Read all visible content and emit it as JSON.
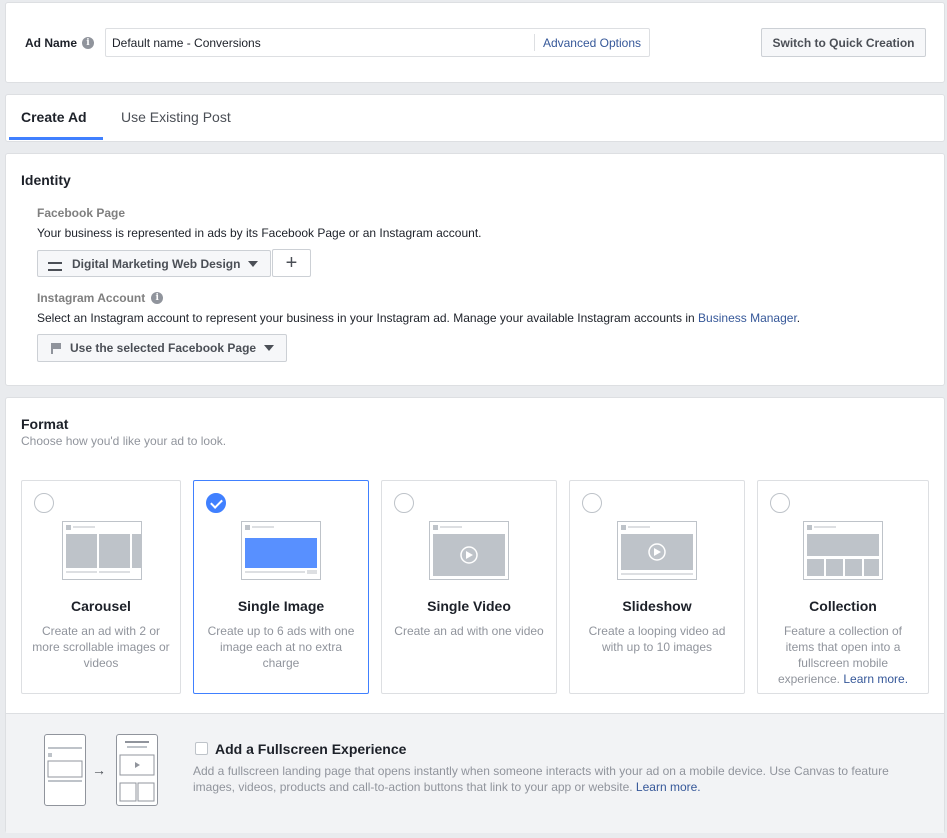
{
  "ad_name": {
    "label": "Ad Name",
    "value": "Default name - Conversions",
    "advanced_options": "Advanced Options",
    "switch_button": "Switch to Quick Creation"
  },
  "tabs": [
    {
      "label": "Create Ad",
      "active": true
    },
    {
      "label": "Use Existing Post",
      "active": false
    }
  ],
  "identity": {
    "title": "Identity",
    "facebook_page_label": "Facebook Page",
    "facebook_page_desc": "Your business is represented in ads by its Facebook Page or an Instagram account.",
    "page_selected": "Digital Marketing Web Design",
    "add_icon": "+",
    "instagram_label": "Instagram Account",
    "instagram_desc": "Select an Instagram account to represent your business in your Instagram ad. Manage your available Instagram accounts in",
    "business_manager": "Business Manager",
    "period": ".",
    "instagram_selected": "Use the selected Facebook Page"
  },
  "format": {
    "title": "Format",
    "subtitle": "Choose how you'd like your ad to look.",
    "options": [
      {
        "name": "Carousel",
        "desc": "Create an ad with 2 or more scrollable images or videos",
        "selected": false
      },
      {
        "name": "Single Image",
        "desc": "Create up to 6 ads with one image each at no extra charge",
        "selected": true
      },
      {
        "name": "Single Video",
        "desc": "Create an ad with one video",
        "selected": false
      },
      {
        "name": "Slideshow",
        "desc": "Create a looping video ad with up to 10 images",
        "selected": false
      },
      {
        "name": "Collection",
        "desc": "Feature a collection of items that open into a fullscreen mobile experience.",
        "learn_more": "Learn more.",
        "selected": false
      }
    ]
  },
  "fullscreen": {
    "title": "Add a Fullscreen Experience",
    "desc": "Add a fullscreen landing page that opens instantly when someone interacts with your ad on a mobile device. Use Canvas to feature images, videos, products and call-to-action buttons that link to your app or website.",
    "learn_more": "Learn more.",
    "arrow": "→"
  },
  "colors": {
    "accent": "#4080ff",
    "link": "#365899"
  },
  "icons": [
    "info-icon",
    "page-icon",
    "flag-icon",
    "caret-down-icon",
    "plus-icon",
    "check-icon",
    "play-icon"
  ]
}
